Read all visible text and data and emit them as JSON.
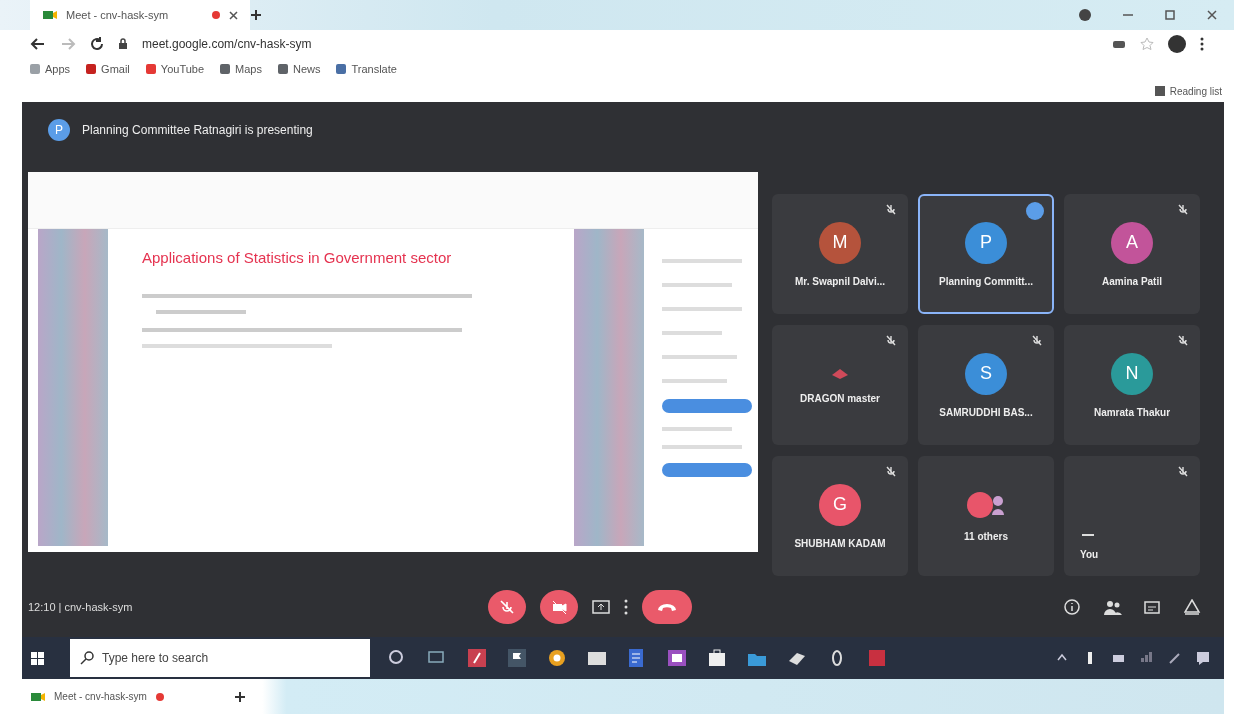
{
  "browser": {
    "tab_title": "Meet - cnv-hask-sym",
    "address": "meet.google.com/cnv-hask-sym",
    "bookmarks": [
      {
        "label": "Apps",
        "color": "#9aa0a6"
      },
      {
        "label": "Gmail",
        "color": "#c5221f"
      },
      {
        "label": "YouTube",
        "color": "#e53935"
      },
      {
        "label": "Maps",
        "color": "#5f6368"
      },
      {
        "label": "News",
        "color": "#5f6368"
      },
      {
        "label": "Translate",
        "color": "#4a6fa5"
      }
    ],
    "reading_list": "Reading list"
  },
  "meet": {
    "presenter": {
      "initial": "P",
      "text": "Planning Committee Ratnagiri is presenting"
    },
    "slide": {
      "title": "Applications of Statistics in Government sector"
    },
    "tiles": [
      {
        "kind": "avatar",
        "name": "Mr. Swapnil Dalvi...",
        "initial": "M",
        "color": "#b5533c",
        "selected": false,
        "muted": true
      },
      {
        "kind": "avatar",
        "name": "Planning Committ...",
        "initial": "P",
        "color": "#3b8ed8",
        "selected": true,
        "muted": false
      },
      {
        "kind": "avatar",
        "name": "Aamina Patil",
        "initial": "A",
        "color": "#c2549a",
        "selected": false,
        "muted": true
      },
      {
        "kind": "logo",
        "name": "DRAGON master",
        "color": "#d04a5a",
        "selected": false,
        "muted": true
      },
      {
        "kind": "avatar",
        "name": "SAMRUDDHI BAS...",
        "initial": "S",
        "color": "#3b8ed8",
        "selected": false,
        "muted": true
      },
      {
        "kind": "avatar",
        "name": "Namrata Thakur",
        "initial": "N",
        "color": "#2a9a9a",
        "selected": false,
        "muted": true
      },
      {
        "kind": "avatar",
        "name": "SHUBHAM KADAM",
        "initial": "G",
        "color": "#e8556a",
        "selected": false,
        "muted": true
      },
      {
        "kind": "others",
        "name": "11 others",
        "color": "#e8556a",
        "selected": false,
        "muted": false
      },
      {
        "kind": "self",
        "name": "You",
        "selected": false,
        "muted": true
      }
    ],
    "meeting_info": "12:10 | cnv-hask-sym"
  },
  "taskbar": {
    "search_placeholder": "Type here to search"
  },
  "bottom_tab_title": "Meet - cnv-hask-sym"
}
